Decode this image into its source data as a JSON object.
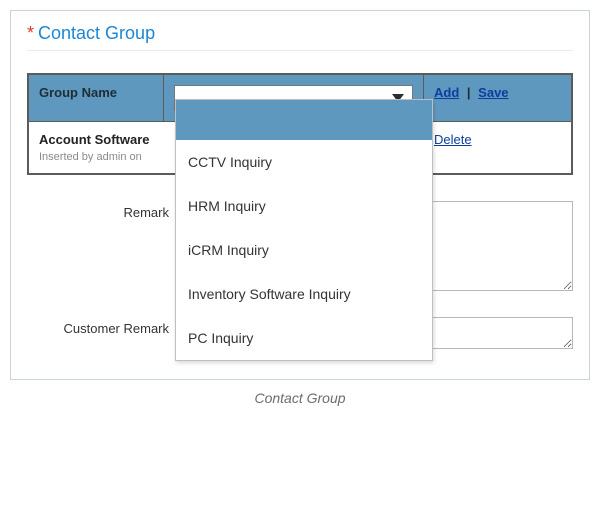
{
  "section": {
    "asterisk": "*",
    "title": "Contact Group",
    "caption": "Contact Group"
  },
  "table": {
    "header_group_name": "Group Name",
    "header_add": "Add",
    "header_pipe": "|",
    "header_save": "Save",
    "row1_name": "Account Software",
    "row1_sub": "Inserted by admin on",
    "row1_action": "Delete"
  },
  "dropdown": {
    "options": [
      "",
      "CCTV Inquiry",
      "HRM Inquiry",
      "iCRM Inquiry",
      "Inventory Software Inquiry",
      "PC Inquiry"
    ]
  },
  "remarks": {
    "remark_label": "Remark",
    "customer_remark_label": "Customer Remark",
    "remark_value": "",
    "customer_remark_value": ""
  }
}
